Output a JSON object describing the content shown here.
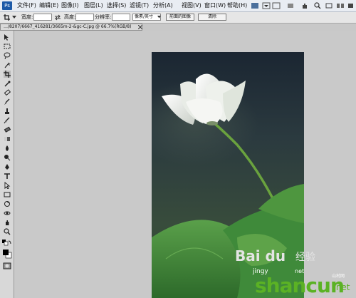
{
  "menubar": {
    "app_icon_label": "Ps",
    "items": [
      "文件(F)",
      "编辑(E)",
      "图像(I)",
      "图层(L)",
      "选择(S)",
      "滤镜(T)",
      "分析(A)",
      "视图(V)",
      "窗口(W)",
      "帮助(H)"
    ]
  },
  "options": {
    "feather_label": "宽度:",
    "height_label": "高度:",
    "resolution_label": "分辨率:",
    "unit_value": "像素/英寸",
    "front_image_button": "前面的图像",
    "clear_button": "清除"
  },
  "document": {
    "tab_title": "…/8207/6667_416281/3665m-2-&gc-C.jpg @ 66.7%(RGB/8)"
  },
  "watermark": {
    "baidu": "Bai du",
    "baidu_jingyan": "经验",
    "url_left": "jingy",
    "url_right": "net",
    "shancun": "shancun",
    "net": ".net",
    "site_label": "山村网"
  },
  "colors": {
    "photo_background": "#1f2c36",
    "leaf_green": "#3f8a3a",
    "flower_white": "#f2f3f0",
    "watermark_green": "#5bb224"
  }
}
